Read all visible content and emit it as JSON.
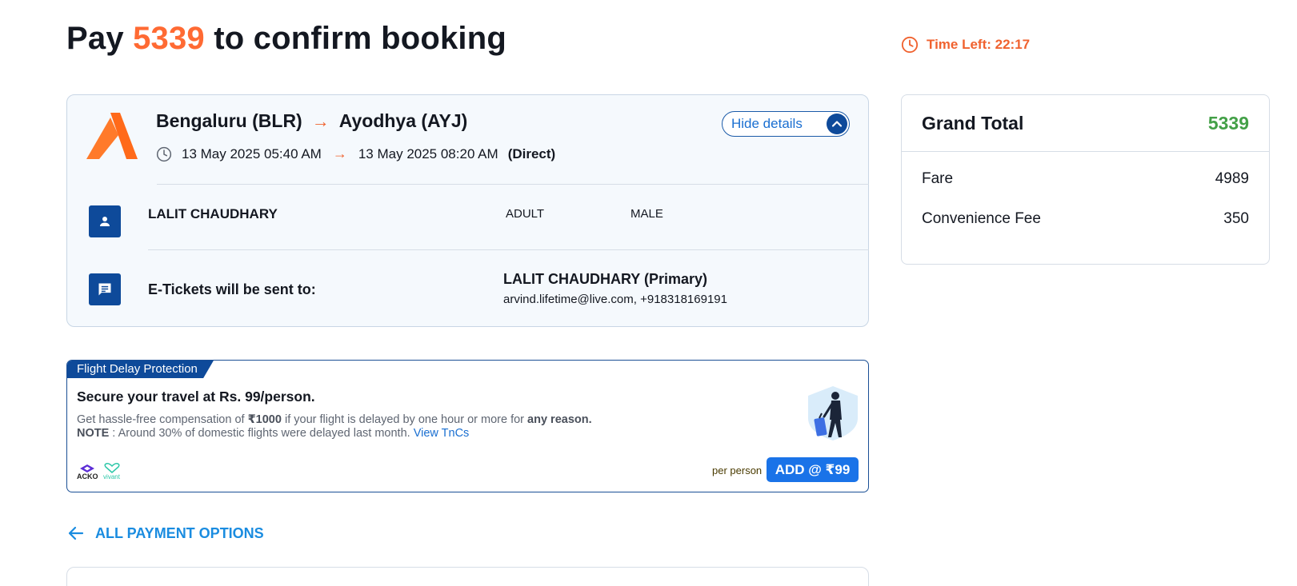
{
  "header": {
    "title_prefix": "Pay ",
    "amount": "5339",
    "title_suffix": " to confirm booking"
  },
  "timer": {
    "label": "Time Left: 22:17",
    "color": "#f0622f"
  },
  "flight": {
    "origin": "Bengaluru (BLR)",
    "destination": "Ayodhya (AYJ)",
    "arrow": "→",
    "departure": "13 May 2025 05:40 AM",
    "arrival": "13 May 2025 08:20 AM",
    "stops": "(Direct)",
    "hide_details_label": "Hide details",
    "airline_logo_color": "#ff6a1a"
  },
  "passenger": {
    "name": "LALIT CHAUDHARY",
    "type": "ADULT",
    "gender": "MALE"
  },
  "eticket": {
    "label": "E-Tickets will be sent to:",
    "contact_name": "LALIT CHAUDHARY (Primary)",
    "contact_info": "arvind.lifetime@live.com, +918318169191"
  },
  "delay_protection": {
    "tag": "Flight Delay Protection",
    "headline": "Secure your travel at Rs. 99/person.",
    "desc_part1": "Get hassle-free compensation of ",
    "desc_amount": "₹1000",
    "desc_part2": " if your flight is delayed by one hour or more for ",
    "desc_reason": "any reason.",
    "note_label": "NOTE",
    "note_text": " : Around 30% of domestic flights were delayed last month. ",
    "tnc_link": "View TnCs",
    "partner1": "ACKO",
    "partner2": "vivant",
    "per_person": "per person",
    "add_button": "ADD @ ₹99"
  },
  "payment": {
    "back_label": "ALL PAYMENT OPTIONS"
  },
  "summary": {
    "title": "Grand Total",
    "total": "5339",
    "rows": [
      {
        "label": "Fare",
        "value": "4989"
      },
      {
        "label": "Convenience Fee",
        "value": "350"
      }
    ],
    "total_color": "#43a047"
  }
}
